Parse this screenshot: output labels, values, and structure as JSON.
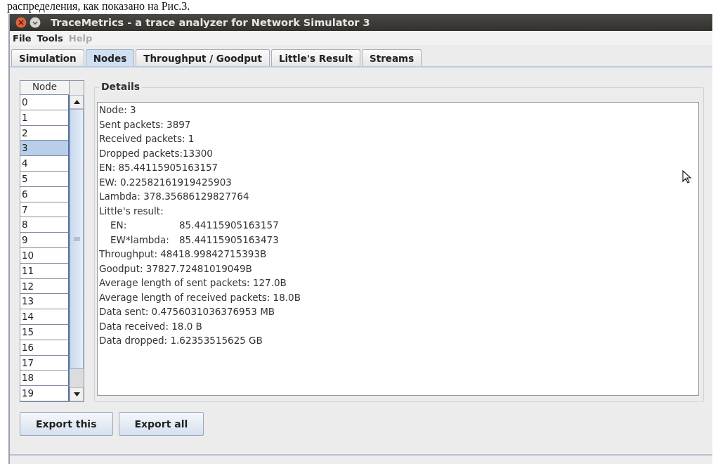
{
  "document_text": "распределения, как показано на Рис.3.",
  "window": {
    "title": "TraceMetrics - a trace analyzer for Network Simulator 3"
  },
  "menu": [
    {
      "label": "File",
      "disabled": false
    },
    {
      "label": "Tools",
      "disabled": false
    },
    {
      "label": "Help",
      "disabled": true
    }
  ],
  "tabs": [
    {
      "label": "Simulation",
      "selected": false
    },
    {
      "label": "Nodes",
      "selected": true
    },
    {
      "label": "Throughput / Goodput",
      "selected": false
    },
    {
      "label": "Little's Result",
      "selected": false
    },
    {
      "label": "Streams",
      "selected": false
    }
  ],
  "node_table": {
    "column": "Node",
    "rows": [
      {
        "label": "0",
        "selected": false
      },
      {
        "label": "1",
        "selected": false
      },
      {
        "label": "2",
        "selected": false
      },
      {
        "label": "3",
        "selected": true
      },
      {
        "label": "4",
        "selected": false
      },
      {
        "label": "5",
        "selected": false
      },
      {
        "label": "6",
        "selected": false
      },
      {
        "label": "7",
        "selected": false
      },
      {
        "label": "8",
        "selected": false
      },
      {
        "label": "9",
        "selected": false
      },
      {
        "label": "10",
        "selected": false
      },
      {
        "label": "11",
        "selected": false
      },
      {
        "label": "12",
        "selected": false
      },
      {
        "label": "13",
        "selected": false
      },
      {
        "label": "14",
        "selected": false
      },
      {
        "label": "15",
        "selected": false
      },
      {
        "label": "16",
        "selected": false
      },
      {
        "label": "17",
        "selected": false
      },
      {
        "label": "18",
        "selected": false
      },
      {
        "label": "19",
        "selected": false
      }
    ]
  },
  "details": {
    "title": "Details",
    "lines": [
      {
        "kind": "line",
        "text": "Node: 3"
      },
      {
        "kind": "line",
        "text": "Sent packets: 3897"
      },
      {
        "kind": "line",
        "text": "Received packets: 1"
      },
      {
        "kind": "line",
        "text": "Dropped packets:13300"
      },
      {
        "kind": "line",
        "text": "EN: 85.44115905163157"
      },
      {
        "kind": "line",
        "text": "EW: 0.22582161919425903"
      },
      {
        "kind": "line",
        "text": "Lambda: 378.35686129827764"
      },
      {
        "kind": "line",
        "text": "Little's result:"
      },
      {
        "kind": "pair",
        "label": "EN:",
        "value": "85.44115905163157"
      },
      {
        "kind": "pair",
        "label": "EW*lambda:",
        "value": "85.44115905163473"
      },
      {
        "kind": "line",
        "text": "Throughput: 48418.99842715393B"
      },
      {
        "kind": "line",
        "text": "Goodput: 37827.72481019049B"
      },
      {
        "kind": "line",
        "text": "Average length of sent packets: 127.0B"
      },
      {
        "kind": "line",
        "text": "Average length of received packets: 18.0B"
      },
      {
        "kind": "line",
        "text": "Data sent: 0.4756031036376953 MB"
      },
      {
        "kind": "line",
        "text": "Data received: 18.0 B"
      },
      {
        "kind": "line",
        "text": "Data dropped: 1.62353515625 GB"
      }
    ]
  },
  "buttons": [
    "Export this",
    "Export all"
  ]
}
